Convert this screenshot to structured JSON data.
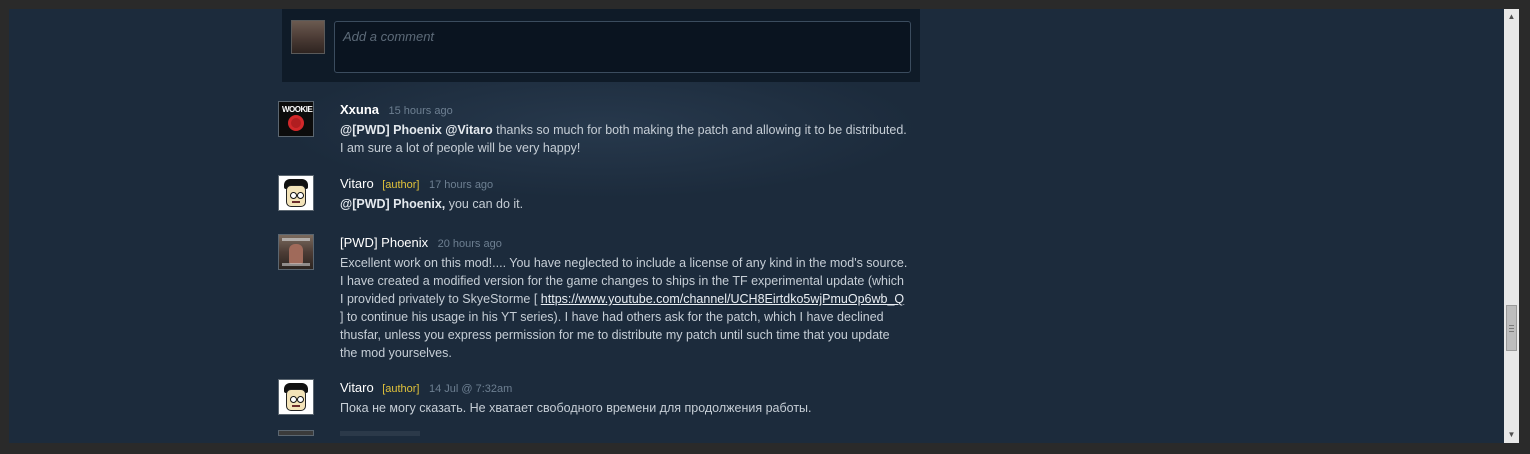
{
  "comment_form": {
    "placeholder": "Add a comment"
  },
  "comments": [
    {
      "author": "Xxuna",
      "timestamp": "15 hours ago",
      "mention": "@[PWD] Phoenix @Vitaro",
      "text": "thanks so much for both making the patch and allowing it to be distributed. I am sure a lot of people will be very happy!"
    },
    {
      "author": "Vitaro",
      "author_tag": "[author]",
      "timestamp": "17 hours ago",
      "mention": "@[PWD] Phoenix,",
      "text": "you can do it."
    },
    {
      "author": "[PWD] Phoenix",
      "timestamp": "20 hours ago",
      "text_before_link": "Excellent work on this mod!.... You have neglected to include a license of any kind in the mod's source. I have created a modified version for the game changes to ships in the TF experimental update (which I provided privately to SkyeStorme [",
      "link": "https://www.youtube.com/channel/UCH8Eirtdko5wjPmuOp6wb_Q",
      "text_after_link": "] to continue his usage in his YT series). I have had others ask for the patch, which I have declined thusfar, unless you express permission for me to distribute my patch until such time that you update the mod yourselves."
    },
    {
      "author": "Vitaro",
      "author_tag": "[author]",
      "timestamp": "14 Jul @ 7:32am",
      "text": "Пока не могу сказать. Не хватает свободного времени для продолжения работы."
    }
  ],
  "scrollbar": {
    "up_icon": "triangle-up-icon",
    "down_icon": "triangle-down-icon"
  }
}
